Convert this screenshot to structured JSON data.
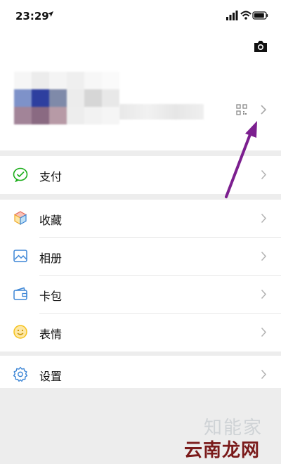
{
  "status": {
    "time": "23:29"
  },
  "menu": {
    "pay": "支付",
    "favorites": "收藏",
    "album": "相册",
    "cards": "卡包",
    "stickers": "表情",
    "settings": "设置"
  },
  "watermark": {
    "line1": "知能家",
    "line2": "云南龙网"
  },
  "colors": {
    "arrow": "#7c1f8f",
    "pay_icon": "#1aad19",
    "blue_icon": "#3d86d6",
    "sticker_icon": "#f5c21b"
  }
}
